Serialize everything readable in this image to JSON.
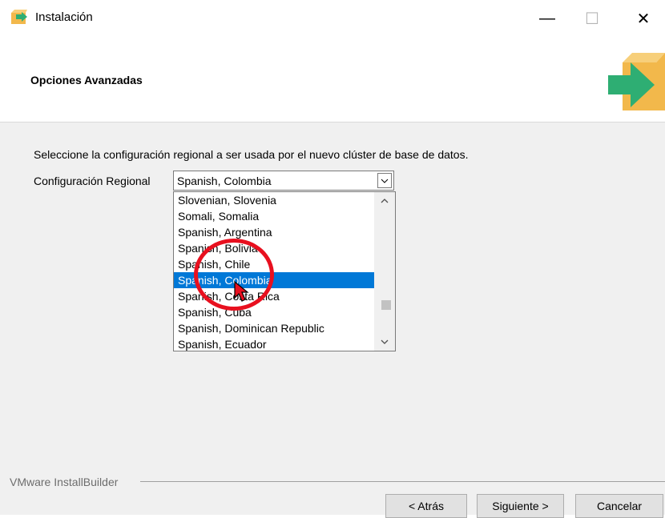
{
  "window": {
    "title": "Instalación",
    "minimize_label": "—",
    "maximize_label": "☐",
    "close_label": "✕"
  },
  "header": {
    "title": "Opciones Avanzadas"
  },
  "content": {
    "description": "Seleccione la configuración regional a ser usada por el nuevo clúster de base de datos.",
    "locale_label": "Configuración Regional",
    "locale_value": "Spanish, Colombia",
    "locale_options": [
      "Slovenian, Slovenia",
      "Somali, Somalia",
      "Spanish, Argentina",
      "Spanish, Bolivia",
      "Spanish, Chile",
      "Spanish, Colombia",
      "Spanish, Costa Rica",
      "Spanish, Cuba",
      "Spanish, Dominican Republic",
      "Spanish, Ecuador"
    ],
    "selected_index": 5
  },
  "footer": {
    "brand": "VMware InstallBuilder",
    "back_label": "< Atrás",
    "next_label": "Siguiente >",
    "cancel_label": "Cancelar"
  },
  "colors": {
    "selection": "#0078d7",
    "annotation": "#e8101f",
    "logo_box": "#f2b84b",
    "logo_arrow": "#2eae73"
  },
  "icons": {
    "app": "installer-box-icon",
    "dropdown": "chevron-down-icon",
    "scroll_up": "chevron-up-icon",
    "scroll_down": "chevron-down-icon",
    "cursor": "mouse-pointer-icon"
  }
}
